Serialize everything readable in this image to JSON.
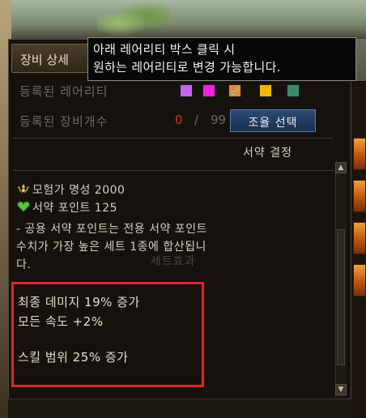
{
  "panel": {
    "tab_label": "장비 상세",
    "registered_rarity_label": "등록된 레어리티",
    "registered_count_label": "등록된 장비개수",
    "count_current": "0",
    "count_separator": "/",
    "count_max": "99",
    "select_button_label": "조율 선택",
    "section_title": "서약 결정"
  },
  "rarity_swatches": [
    {
      "name": "rare",
      "color": "#c860f0",
      "checked": false
    },
    {
      "name": "unique",
      "color": "#f020e0",
      "checked": false
    },
    {
      "name": "legendary",
      "color": "#e08a30",
      "checked": true
    },
    {
      "name": "epic",
      "color": "#f0b800",
      "checked": false
    },
    {
      "name": "taecho",
      "color": "#3a8a6a",
      "checked": false
    }
  ],
  "info": {
    "fame_line": "모험가 명성 2000",
    "points_line": "서약 포인트 125",
    "desc_line1": "- 공용 서약 포인트는 전용 서약 포인트",
    "desc_line2": "수치가 가장 높은 세트 1종에 합산됩니",
    "desc_line3": "다.",
    "faded_text": "세트효과"
  },
  "effects": {
    "line1": "최종 데미지 19% 증가",
    "line2": "모든 속도 +2%",
    "line3": "스킬 범위 25% 증가"
  },
  "tooltip": {
    "line1": "아래 레어리티 박스 클릭 시",
    "line2": "원하는 레어리티로 변경 가능합니다."
  },
  "icons": {
    "fame": "laurel-crest-icon",
    "points": "green-heart-icon",
    "checkmark": "checkmark-icon"
  },
  "colors": {
    "count_zero": "#c8361e",
    "highlight_box": "#e0262a",
    "button_blue": "#2b4a74"
  }
}
